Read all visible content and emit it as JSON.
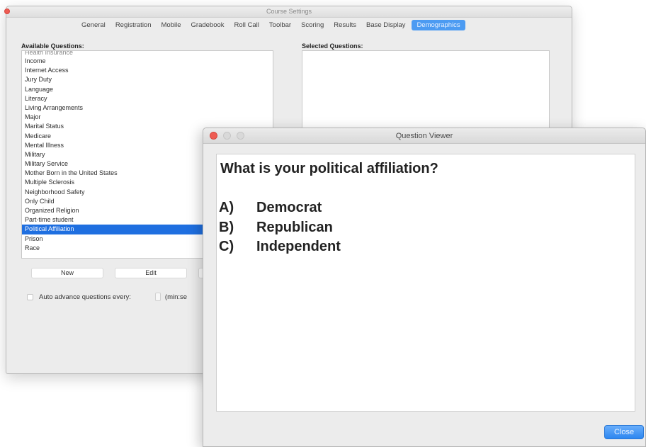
{
  "settings_window": {
    "title": "Course Settings",
    "tabs": [
      {
        "label": "General",
        "active": false
      },
      {
        "label": "Registration",
        "active": false
      },
      {
        "label": "Mobile",
        "active": false
      },
      {
        "label": "Gradebook",
        "active": false
      },
      {
        "label": "Roll Call",
        "active": false
      },
      {
        "label": "Toolbar",
        "active": false
      },
      {
        "label": "Scoring",
        "active": false
      },
      {
        "label": "Results",
        "active": false
      },
      {
        "label": "Base Display",
        "active": false
      },
      {
        "label": "Demographics",
        "active": true
      }
    ],
    "available_label": "Available Questions:",
    "selected_label": "Selected Questions:",
    "available_items": [
      "Health Insurance",
      "Income",
      "Internet Access",
      "Jury Duty",
      "Language",
      "Literacy",
      "Living Arrangements",
      "Major",
      "Marital Status",
      "Medicare",
      "Mental Illness",
      "Military",
      "Military Service",
      "Mother Born in the United States",
      "Multiple Sclerosis",
      "Neighborhood Safety",
      "Only Child",
      "Organized Religion",
      "Part-time student",
      "Political Affiliation",
      "Prison",
      "Race"
    ],
    "selected_item": "Political Affiliation",
    "buttons": {
      "new": "New",
      "edit": "Edit"
    },
    "auto_advance_label": "Auto advance questions every:",
    "auto_advance_unit": "(min:se"
  },
  "viewer_window": {
    "title": "Question Viewer",
    "question": "What is your political affiliation?",
    "answers": [
      {
        "letter": "A)",
        "text": "Democrat"
      },
      {
        "letter": "B)",
        "text": "Republican"
      },
      {
        "letter": "C)",
        "text": "Independent"
      }
    ],
    "close_label": "Close"
  },
  "colors": {
    "accent": "#2c86f0",
    "selection": "#1f6fe0",
    "close_dot": "#ee5c53"
  }
}
